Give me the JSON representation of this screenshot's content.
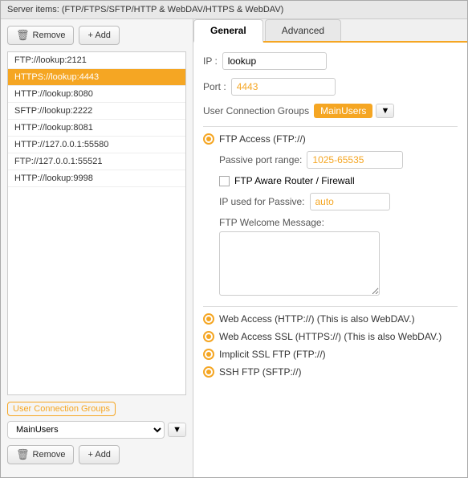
{
  "window": {
    "title": "Server items: (FTP/FTPS/SFTP/HTTP & WebDAV/HTTPS & WebDAV)"
  },
  "left_panel": {
    "remove_button": "Remove",
    "add_button": "+ Add",
    "server_list": [
      {
        "label": "FTP://lookup:2121",
        "selected": false
      },
      {
        "label": "HTTPS://lookup:4443",
        "selected": true
      },
      {
        "label": "HTTP://lookup:8080",
        "selected": false
      },
      {
        "label": "SFTP://lookup:2222",
        "selected": false
      },
      {
        "label": "HTTP://lookup:8081",
        "selected": false
      },
      {
        "label": "HTTP://127.0.0.1:55580",
        "selected": false
      },
      {
        "label": "FTP://127.0.0.1:55521",
        "selected": false
      },
      {
        "label": "HTTP://lookup:9998",
        "selected": false
      }
    ],
    "user_groups_label": "User Connection Groups",
    "selected_group": "MainUsers",
    "remove_bottom_button": "Remove",
    "add_bottom_button": "+ Add"
  },
  "right_panel": {
    "tabs": [
      {
        "label": "General",
        "active": true
      },
      {
        "label": "Advanced",
        "active": false
      }
    ],
    "general": {
      "ip_label": "IP :",
      "ip_value": "lookup",
      "port_label": "Port :",
      "port_value": "4443",
      "ucg_label": "User Connection Groups",
      "ucg_value": "MainUsers",
      "ftp_section_label": "FTP Access (FTP://)",
      "passive_port_label": "Passive port range:",
      "passive_port_value": "1025-65535",
      "ftp_aware_label": "FTP Aware Router / Firewall",
      "ip_passive_label": "IP used for Passive:",
      "ip_passive_value": "auto",
      "welcome_label": "FTP Welcome Message:",
      "web_access_label": "Web Access (HTTP://) (This is also WebDAV.)",
      "web_access_ssl_label": "Web Access SSL (HTTPS://) (This is also WebDAV.)",
      "implicit_ssl_label": "Implicit SSL FTP (FTP://)",
      "ssh_ftp_label": "SSH FTP (SFTP://)"
    }
  }
}
